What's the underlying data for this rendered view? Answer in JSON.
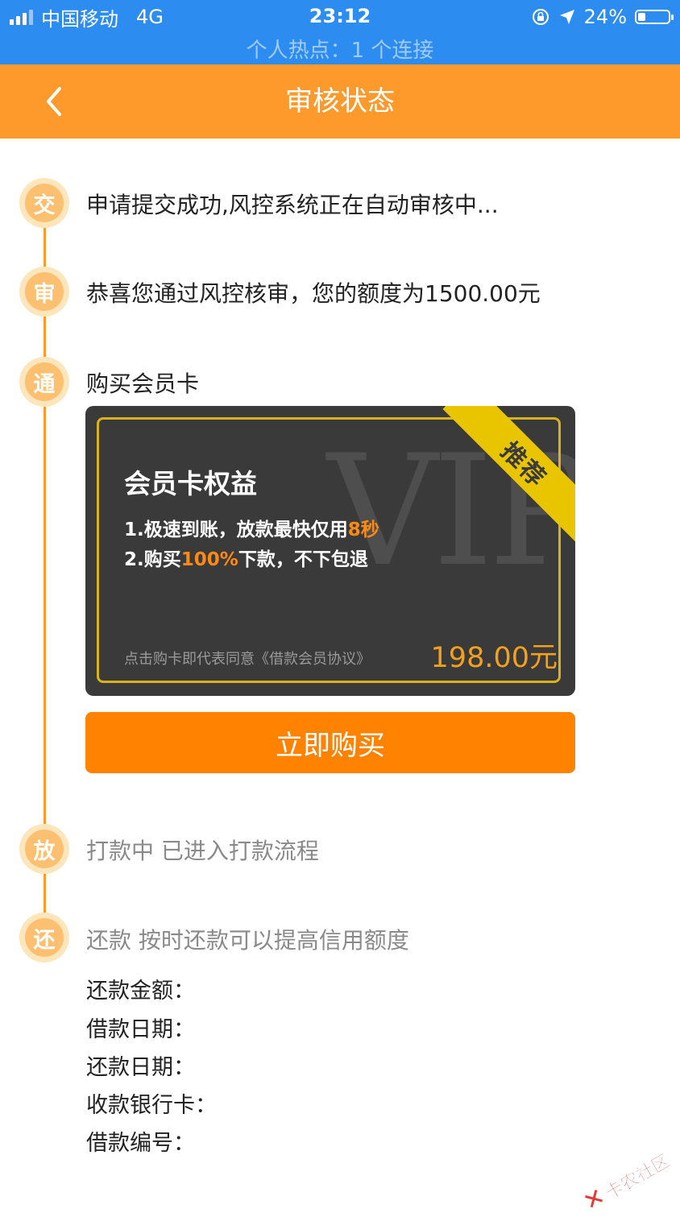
{
  "status_bar": {
    "carrier": "中国移动",
    "network": "4G",
    "time": "23:12",
    "battery": "24%",
    "battery_level": 0.24,
    "hotspot": "个人热点：1 个连接"
  },
  "header": {
    "title": "审核状态",
    "back_icon": "chevron-left-icon"
  },
  "colors": {
    "accent": "#fe9a2b",
    "button": "#ff8200",
    "status_bar": "#2d8cf0",
    "card_bg": "#3a3a3a",
    "card_border": "#d9b21e"
  },
  "steps": [
    {
      "badge": "交",
      "text": "申请提交成功,风控系统正在自动审核中..."
    },
    {
      "badge": "审",
      "text": "恭喜您通过风控核审，您的额度为1500.00元"
    },
    {
      "badge": "通",
      "text": "购买会员卡"
    },
    {
      "badge": "放",
      "text": "打款中 已进入打款流程"
    },
    {
      "badge": "还",
      "text": "还款 按时还款可以提高信用额度"
    }
  ],
  "card": {
    "watermark": "VIP",
    "ribbon": "推荐",
    "title": "会员卡权益",
    "line1_prefix": "1.极速到账，放款最快仅用",
    "line1_highlight": "8秒",
    "line2_prefix": "2.购买",
    "line2_highlight": "100%",
    "line2_suffix": "下款，不下包退",
    "agreement": "点击购卡即代表同意《借款会员协议》",
    "price": "198.00元"
  },
  "buy_button": "立即购买",
  "repayment": {
    "amount_label": "还款金额：",
    "loan_date_label": "借款日期：",
    "repay_date_label": "还款日期：",
    "bank_card_label": "收款银行卡：",
    "loan_number_label": "借款编号："
  },
  "watermark": {
    "mark": "✕",
    "text": "卡农社区"
  }
}
